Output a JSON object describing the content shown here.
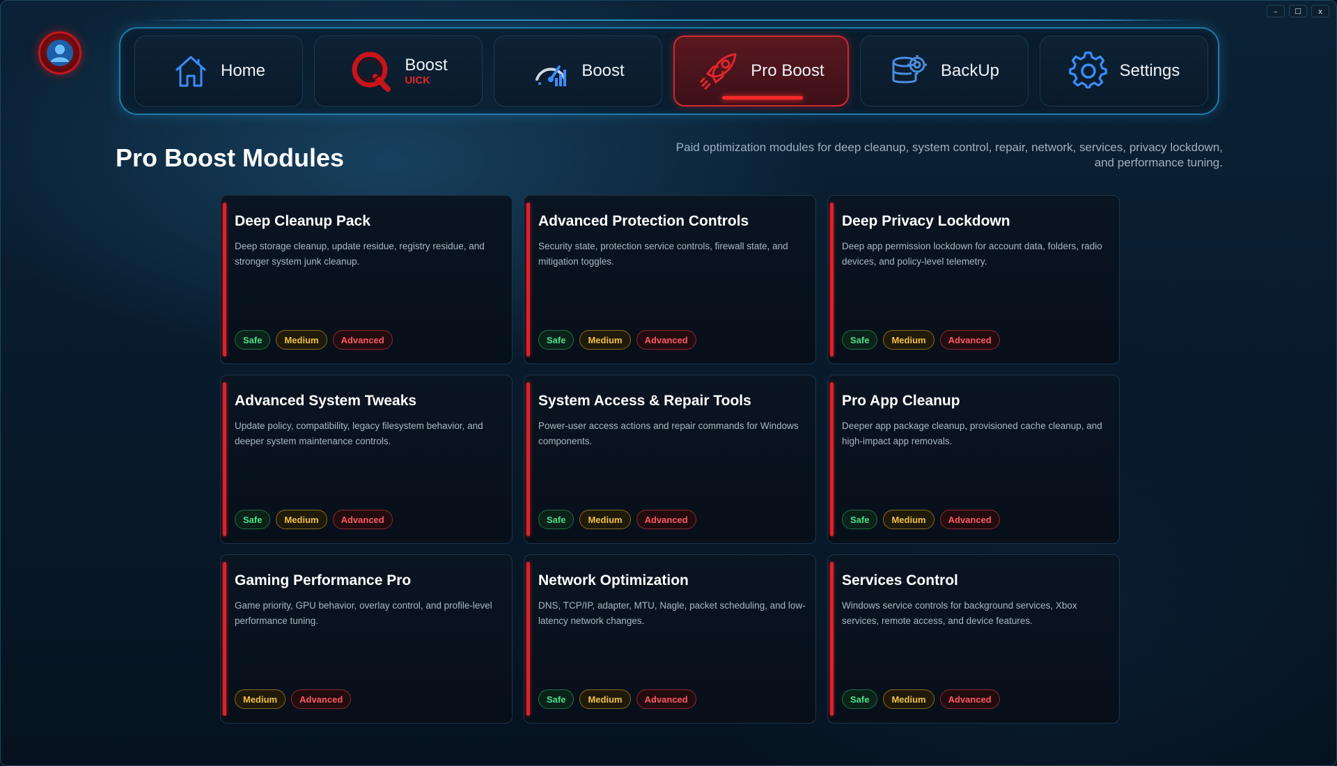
{
  "window": {
    "controls": {
      "minimize": "–",
      "maximize": "☐",
      "close": "x"
    }
  },
  "nav": {
    "items": [
      {
        "label": "Home",
        "icon": "home-icon"
      },
      {
        "label": "Boost",
        "sublabel": "UICK",
        "icon": "quick-boost-logo-icon"
      },
      {
        "label": "Boost",
        "icon": "speedometer-icon"
      },
      {
        "label": "Pro Boost",
        "icon": "rocket-icon",
        "active": true
      },
      {
        "label": "BackUp",
        "icon": "database-gear-icon"
      },
      {
        "label": "Settings",
        "icon": "gear-icon"
      }
    ]
  },
  "header": {
    "title": "Pro Boost Modules",
    "description_line1": "Paid optimization modules for deep cleanup, system control, repair, network, services, privacy lockdown,",
    "description_line2": "and performance tuning."
  },
  "tag_labels": {
    "safe": "Safe",
    "medium": "Medium",
    "advanced": "Advanced"
  },
  "modules": [
    {
      "title": "Deep Cleanup Pack",
      "desc": "Deep storage cleanup, update residue, registry residue, and stronger system junk cleanup.",
      "tags": [
        "safe",
        "medium",
        "advanced"
      ]
    },
    {
      "title": "Advanced Protection Controls",
      "desc": "Security state, protection service controls, firewall state, and mitigation toggles.",
      "tags": [
        "safe",
        "medium",
        "advanced"
      ]
    },
    {
      "title": "Deep Privacy Lockdown",
      "desc": "Deep app permission lockdown for account data, folders, radio devices, and policy-level telemetry.",
      "tags": [
        "safe",
        "medium",
        "advanced"
      ]
    },
    {
      "title": "Advanced System Tweaks",
      "desc": "Update policy, compatibility, legacy filesystem behavior, and deeper system maintenance controls.",
      "tags": [
        "safe",
        "medium",
        "advanced"
      ]
    },
    {
      "title": "System Access & Repair Tools",
      "desc": "Power-user access actions and repair commands for Windows components.",
      "tags": [
        "safe",
        "medium",
        "advanced"
      ]
    },
    {
      "title": "Pro App Cleanup",
      "desc": "Deeper app package cleanup, provisioned cache cleanup, and high-impact app removals.",
      "tags": [
        "safe",
        "medium",
        "advanced"
      ]
    },
    {
      "title": "Gaming Performance Pro",
      "desc": "Game priority, GPU behavior, overlay control, and profile-level performance tuning.",
      "tags": [
        "medium",
        "advanced"
      ]
    },
    {
      "title": "Network Optimization",
      "desc": "DNS, TCP/IP, adapter, MTU, Nagle, packet scheduling, and low-latency network changes.",
      "tags": [
        "safe",
        "medium",
        "advanced"
      ]
    },
    {
      "title": "Services Control",
      "desc": "Windows service controls for background services, Xbox services, remote access, and device features.",
      "tags": [
        "safe",
        "medium",
        "advanced"
      ]
    }
  ],
  "colors": {
    "accent_red": "#e3202a",
    "nav_border": "#1f7ca8",
    "safe": "#4be08a",
    "medium": "#f0c24a",
    "advanced": "#ff5a60"
  }
}
